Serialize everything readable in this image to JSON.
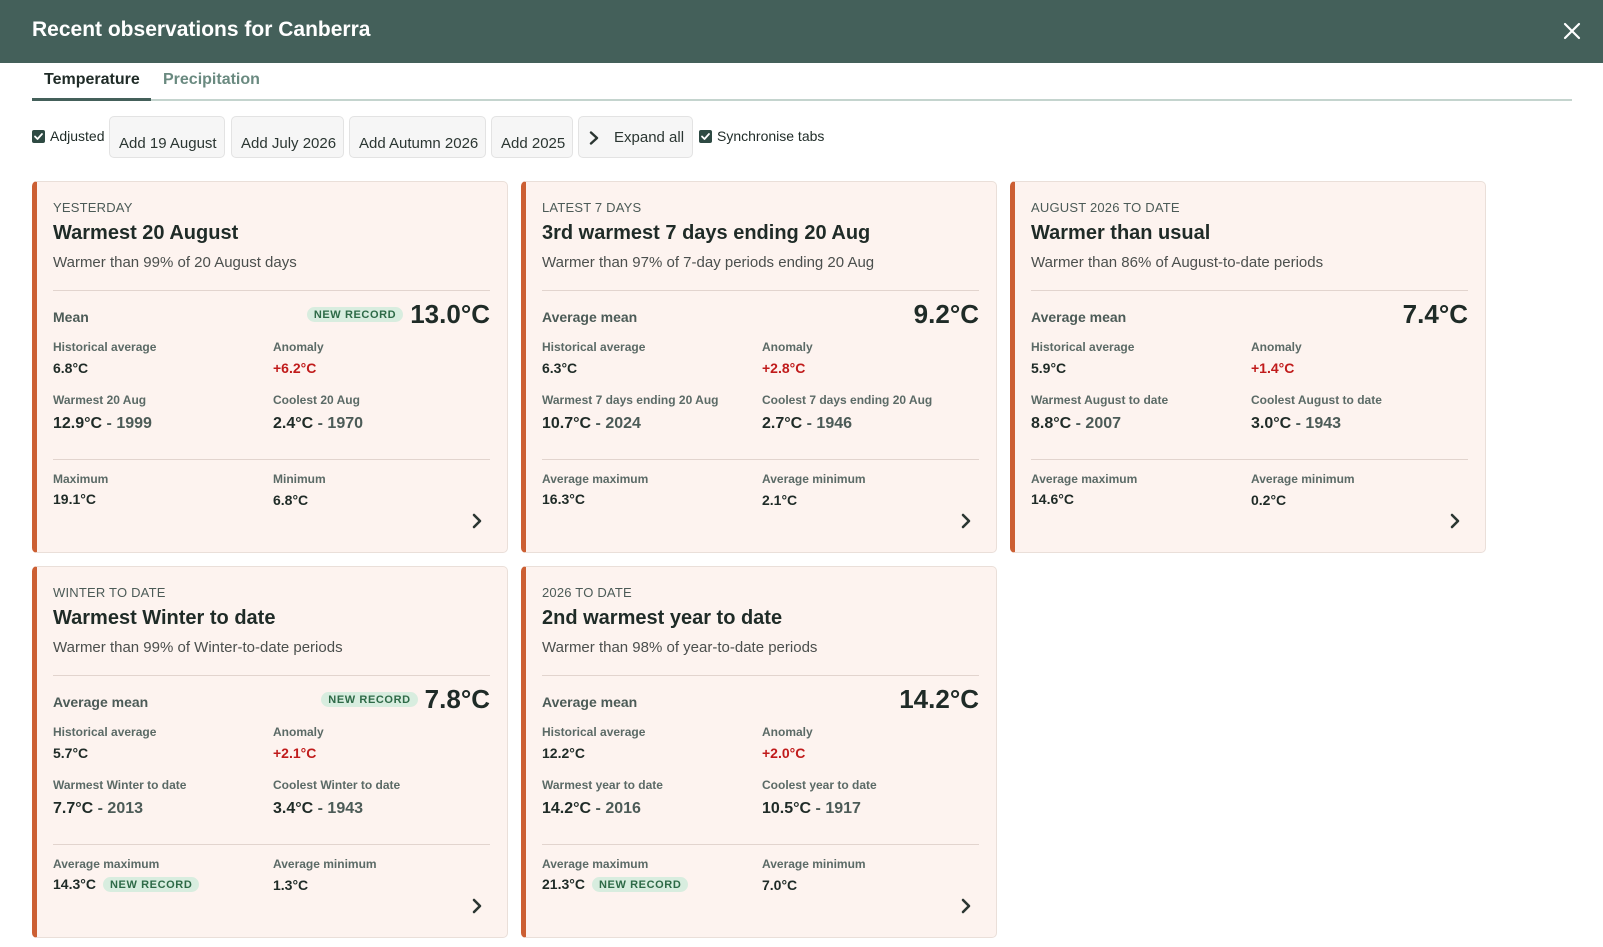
{
  "header": {
    "title": "Recent observations for Canberra"
  },
  "tabs": [
    {
      "label": "Temperature"
    },
    {
      "label": "Precipitation"
    }
  ],
  "toolbar": {
    "adjusted_label": "Adjusted",
    "adjusted_checked": true,
    "buttons": [
      {
        "label": "Add 19 August"
      },
      {
        "label": "Add July 2026"
      },
      {
        "label": "Add Autumn 2026"
      },
      {
        "label": "Add 2025"
      }
    ],
    "expand_label": "Expand all",
    "sync_label": "Synchronise tabs",
    "sync_checked": true
  },
  "record_badge": "NEW RECORD",
  "colors": {
    "header": "#44605a",
    "card_accent": "#cc5f33",
    "card_bg": "#fdf3ef",
    "anomaly": "#c01b1b",
    "badge_bg": "#d8eddf"
  },
  "cards": [
    {
      "period": "YESTERDAY",
      "title": "Warmest 20 August",
      "subtitle": "Warmer than 99% of 20 August days",
      "mean_label": "Mean",
      "mean_value": "13.0°C",
      "mean_record": true,
      "hist_label": "Historical average",
      "hist_value": "6.8°C",
      "anom_label": "Anomaly",
      "anom_value": "+6.2°C",
      "warmest_label": "Warmest 20 Aug",
      "warmest_value": "12.9°C",
      "warmest_year": "1999",
      "coolest_label": "Coolest 20 Aug",
      "coolest_value": "2.4°C",
      "coolest_year": "1970",
      "max_label": "Maximum",
      "max_value": "19.1°C",
      "max_record": false,
      "min_label": "Minimum",
      "min_value": "6.8°C"
    },
    {
      "period": "LATEST 7 DAYS",
      "title": "3rd warmest 7 days ending 20 Aug",
      "subtitle": "Warmer than 97% of 7-day periods ending 20 Aug",
      "mean_label": "Average mean",
      "mean_value": "9.2°C",
      "mean_record": false,
      "hist_label": "Historical average",
      "hist_value": "6.3°C",
      "anom_label": "Anomaly",
      "anom_value": "+2.8°C",
      "warmest_label": "Warmest 7 days ending 20 Aug",
      "warmest_value": "10.7°C",
      "warmest_year": "2024",
      "coolest_label": "Coolest 7 days ending 20 Aug",
      "coolest_value": "2.7°C",
      "coolest_year": "1946",
      "max_label": "Average maximum",
      "max_value": "16.3°C",
      "max_record": false,
      "min_label": "Average minimum",
      "min_value": "2.1°C"
    },
    {
      "period": "AUGUST 2026 TO DATE",
      "title": "Warmer than usual",
      "subtitle": "Warmer than 86% of August-to-date periods",
      "mean_label": "Average mean",
      "mean_value": "7.4°C",
      "mean_record": false,
      "hist_label": "Historical average",
      "hist_value": "5.9°C",
      "anom_label": "Anomaly",
      "anom_value": "+1.4°C",
      "warmest_label": "Warmest August to date",
      "warmest_value": "8.8°C",
      "warmest_year": "2007",
      "coolest_label": "Coolest August to date",
      "coolest_value": "3.0°C",
      "coolest_year": "1943",
      "max_label": "Average maximum",
      "max_value": "14.6°C",
      "max_record": false,
      "min_label": "Average minimum",
      "min_value": "0.2°C"
    },
    {
      "period": "WINTER TO DATE",
      "title": "Warmest Winter to date",
      "subtitle": "Warmer than 99% of Winter-to-date periods",
      "mean_label": "Average mean",
      "mean_value": "7.8°C",
      "mean_record": true,
      "hist_label": "Historical average",
      "hist_value": "5.7°C",
      "anom_label": "Anomaly",
      "anom_value": "+2.1°C",
      "warmest_label": "Warmest Winter to date",
      "warmest_value": "7.7°C",
      "warmest_year": "2013",
      "coolest_label": "Coolest Winter to date",
      "coolest_value": "3.4°C",
      "coolest_year": "1943",
      "max_label": "Average maximum",
      "max_value": "14.3°C",
      "max_record": true,
      "min_label": "Average minimum",
      "min_value": "1.3°C"
    },
    {
      "period": "2026 TO DATE",
      "title": "2nd warmest year to date",
      "subtitle": "Warmer than 98% of year-to-date periods",
      "mean_label": "Average mean",
      "mean_value": "14.2°C",
      "mean_record": false,
      "hist_label": "Historical average",
      "hist_value": "12.2°C",
      "anom_label": "Anomaly",
      "anom_value": "+2.0°C",
      "warmest_label": "Warmest year to date",
      "warmest_value": "14.2°C",
      "warmest_year": "2016",
      "coolest_label": "Coolest year to date",
      "coolest_value": "10.5°C",
      "coolest_year": "1917",
      "max_label": "Average maximum",
      "max_value": "21.3°C",
      "max_record": true,
      "min_label": "Average minimum",
      "min_value": "7.0°C"
    }
  ]
}
